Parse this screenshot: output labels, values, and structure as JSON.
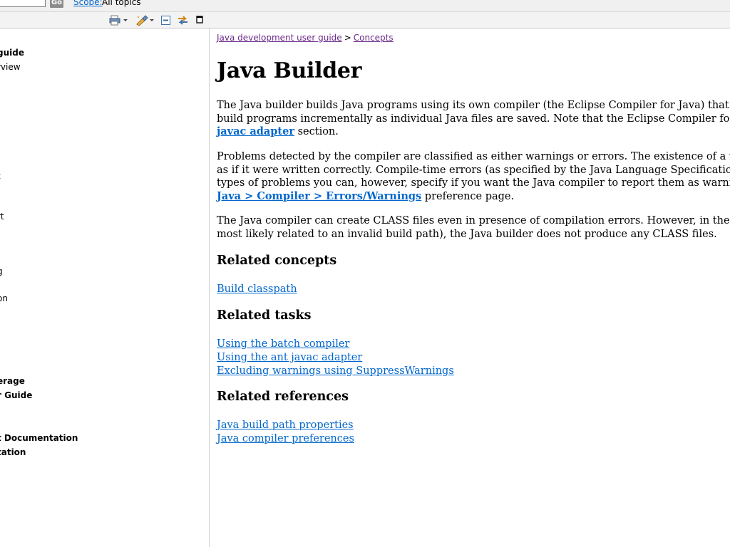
{
  "search": {
    "go_label": "Go",
    "scope_label": "Scope",
    "scope_value": "All topics"
  },
  "toolbar": {
    "icons": [
      "print-icon",
      "highlight-search-icon",
      "collapse-all-icon",
      "link-with-contents-icon",
      "maximize-icon"
    ]
  },
  "nav": {
    "items": [
      {
        "text": "guide",
        "bold": true
      },
      {
        "text": "rview",
        "bold": false
      },
      {
        "text": "t",
        "bold": false
      },
      {
        "text": "rt",
        "bold": false
      },
      {
        "text": "g",
        "bold": false
      },
      {
        "text": "on",
        "bold": false
      },
      {
        "text": "erage",
        "bold": true
      },
      {
        "text": "r Guide",
        "bold": true
      },
      {
        "text": "t Documentation",
        "bold": true
      },
      {
        "text": "tation",
        "bold": true
      }
    ]
  },
  "breadcrumb": {
    "item1": "Java development user guide",
    "separator": ">",
    "item2": "Concepts"
  },
  "page": {
    "title": "Java Builder",
    "p1": {
      "line1": "The Java builder builds Java programs using its own compiler (the Eclipse Compiler for Java) that implements th",
      "line2": "build programs incrementally as individual Java files are saved. Note that the Eclipse Compiler for Java can also",
      "line3_link": "javac adapter",
      "line3_rest": " section."
    },
    "p2": {
      "line1": "Problems detected by the compiler are classified as either warnings or errors. The existence of a warning does no",
      "line2": "as if it were written correctly. Compile-time errors (as specified by the Java Language Specification) are always",
      "line3": "types of problems you can, however, specify if you want the Java compiler to report them as warnings, errors or",
      "line4_link": "Java > Compiler > Errors/Warnings",
      "line4_rest": " preference page."
    },
    "p3": {
      "line1": "The Java compiler can create CLASS files even in presence of compilation errors. However, in the case of seriou",
      "line2": "most likely related to an invalid build path), the Java builder does not produce any CLASS files."
    }
  },
  "related_concepts": {
    "heading": "Related concepts",
    "links": [
      "Build classpath"
    ]
  },
  "related_tasks": {
    "heading": "Related tasks",
    "links": [
      "Using the batch compiler",
      "Using the ant javac adapter",
      "Excluding warnings using SuppressWarnings"
    ]
  },
  "related_references": {
    "heading": "Related references",
    "links": [
      "Java build path properties",
      "Java compiler preferences"
    ]
  },
  "colors": {
    "link": "#0066cc",
    "visited_link": "#6b2a8a",
    "toolbar_bg": "#f3f3f3"
  }
}
